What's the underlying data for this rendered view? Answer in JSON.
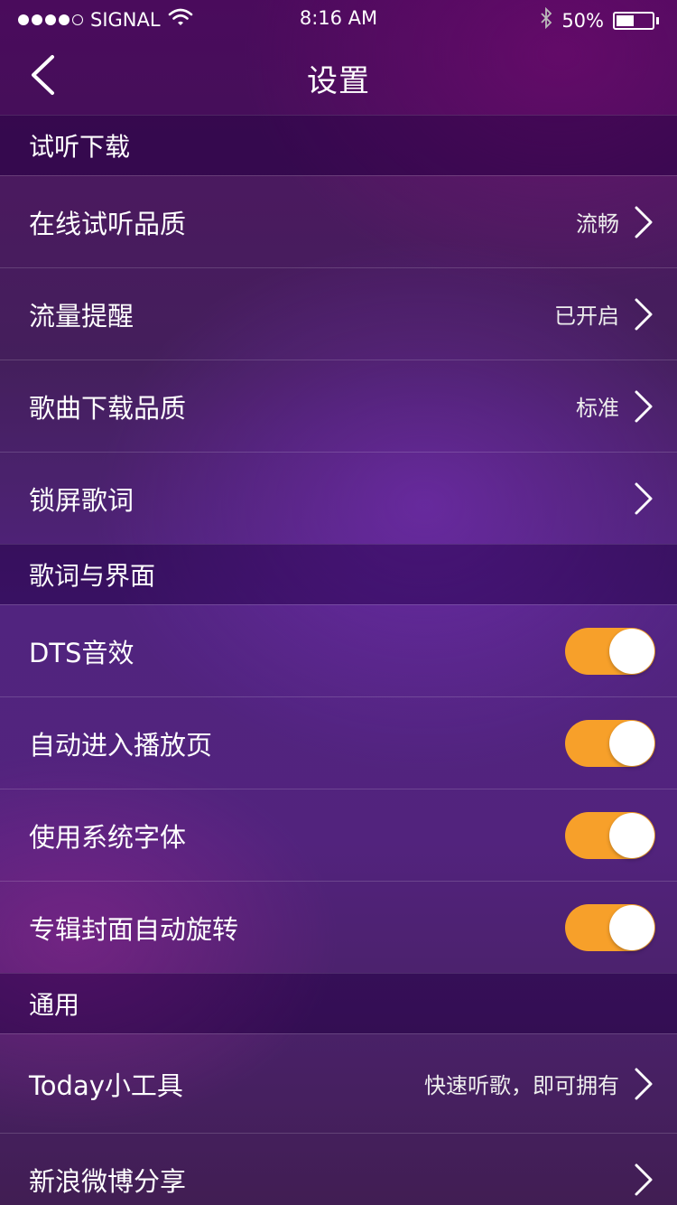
{
  "status_bar": {
    "carrier": "SIGNAL",
    "time": "8:16 AM",
    "battery_percent": "50%",
    "battery_level": 0.5,
    "signal_bars_filled": 4,
    "signal_bars_total": 5
  },
  "nav": {
    "title": "设置",
    "back_icon": "chevron-left-icon"
  },
  "sections": [
    {
      "header": "试听下载",
      "rows": [
        {
          "label": "在线试听品质",
          "value": "流畅",
          "control": "chevron"
        },
        {
          "label": "流量提醒",
          "value": "已开启",
          "control": "chevron"
        },
        {
          "label": "歌曲下载品质",
          "value": "标准",
          "control": "chevron"
        },
        {
          "label": "锁屏歌词",
          "value": "",
          "control": "chevron"
        }
      ]
    },
    {
      "header": "歌词与界面",
      "rows": [
        {
          "label": "DTS音效",
          "control": "toggle",
          "on": true
        },
        {
          "label": "自动进入播放页",
          "control": "toggle",
          "on": true
        },
        {
          "label": "使用系统字体",
          "control": "toggle",
          "on": true
        },
        {
          "label": "专辑封面自动旋转",
          "control": "toggle",
          "on": true
        }
      ]
    },
    {
      "header": "通用",
      "rows": [
        {
          "label": "Today小工具",
          "value": "快速听歌，即可拥有",
          "control": "chevron"
        },
        {
          "label": "新浪微博分享",
          "value": "",
          "control": "chevron"
        }
      ]
    }
  ],
  "colors": {
    "toggle_on": "#f7a02a",
    "background_primary": "#4a1c7a"
  }
}
